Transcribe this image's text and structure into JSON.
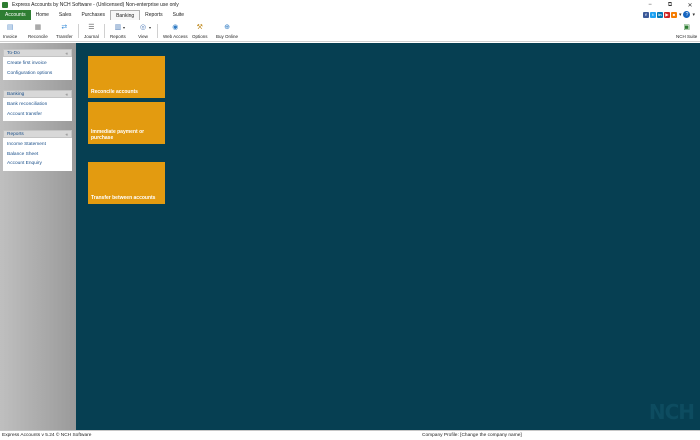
{
  "window": {
    "title": "Express Accounts by NCH Software - (Unlicensed) Non-enterprise use only",
    "minimize_glyph": "−",
    "maximize_glyph": "⧉",
    "close_glyph": "✕"
  },
  "menu": {
    "items": [
      {
        "label": "Accounts"
      },
      {
        "label": "Home"
      },
      {
        "label": "Sales"
      },
      {
        "label": "Purchases"
      },
      {
        "label": "Banking"
      },
      {
        "label": "Reports"
      },
      {
        "label": "Suite"
      }
    ],
    "social": [
      {
        "name": "facebook-icon",
        "glyph": "f",
        "color": "#3b5998"
      },
      {
        "name": "twitter-icon",
        "glyph": "t",
        "color": "#1da1f2"
      },
      {
        "name": "linkedin-icon",
        "glyph": "in",
        "color": "#0077b5"
      },
      {
        "name": "youtube-icon",
        "glyph": "▶",
        "color": "#cc2222"
      },
      {
        "name": "feed-icon",
        "glyph": "■",
        "color": "#f57c00"
      }
    ],
    "help_glyph": "?",
    "arrow_glyph": "▾"
  },
  "toolbar": {
    "buttons": [
      {
        "label": "Invoice",
        "glyph": "▤",
        "color": "#5d8fc9"
      },
      {
        "label": "Reconcile",
        "glyph": "▦",
        "color": "#7a7a7a"
      },
      {
        "label": "Transfer",
        "glyph": "⇄",
        "color": "#3b8ed8"
      },
      {
        "label": "Journal",
        "glyph": "☰",
        "color": "#5a5a5a"
      },
      {
        "label": "Reports",
        "glyph": "▥",
        "color": "#4a78b5"
      },
      {
        "label": "View",
        "glyph": "◎",
        "color": "#4a78b5"
      },
      {
        "label": "Web Access",
        "glyph": "◉",
        "color": "#2f7bc4"
      },
      {
        "label": "Options",
        "glyph": "⚒",
        "color": "#c08a1e"
      },
      {
        "label": "Buy Online",
        "glyph": "⊕",
        "color": "#2f7bc4"
      },
      {
        "label": "NCH Suite",
        "glyph": "▣",
        "color": "#2e7d32"
      }
    ],
    "dropdown_glyph": "▾"
  },
  "sidebar": {
    "panels": [
      {
        "title": "To-Do",
        "collapse": "«",
        "links": [
          "Create first invoice",
          "Configuration options"
        ]
      },
      {
        "title": "Banking",
        "collapse": "«",
        "links": [
          "Bank reconciliation",
          "Account transfer"
        ]
      },
      {
        "title": "Reports",
        "collapse": "«",
        "links": [
          "Income Statement",
          "Balance Sheet",
          "Account Enquiry"
        ]
      }
    ]
  },
  "tiles": [
    {
      "label": "Reconcile accounts"
    },
    {
      "label": "Immediate payment or purchase"
    },
    {
      "label": "Transfer between accounts"
    }
  ],
  "watermark": "NCH",
  "status": {
    "left": "Express Accounts v 5.24 © NCH Software",
    "right": "Company Profile: [Change the company name]"
  },
  "colors": {
    "accent_green": "#2e7d32",
    "main_background": "#063f52",
    "tile_orange": "#e39b10",
    "link_blue": "#1a4f8a"
  }
}
